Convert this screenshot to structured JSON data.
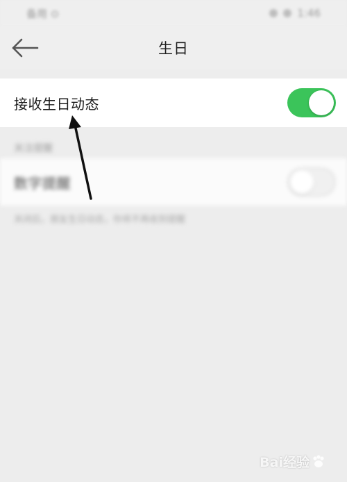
{
  "status_bar": {
    "left_text": "备用 ⊙",
    "right_text": "1:46"
  },
  "header": {
    "title": "生日",
    "back_icon": "arrow-left-icon"
  },
  "settings": {
    "birthday_updates": {
      "label": "接收生日动态",
      "enabled": true
    },
    "reminder_section": {
      "header": "关注提醒",
      "label": "数字提醒",
      "enabled": false,
      "hint": "关闭后，朋友生日动态，你将不再收到提醒"
    }
  },
  "watermark": {
    "text": "Bai经验"
  },
  "colors": {
    "toggle_on": "#3bc45a",
    "background": "#ededed",
    "row_background": "#ffffff"
  }
}
